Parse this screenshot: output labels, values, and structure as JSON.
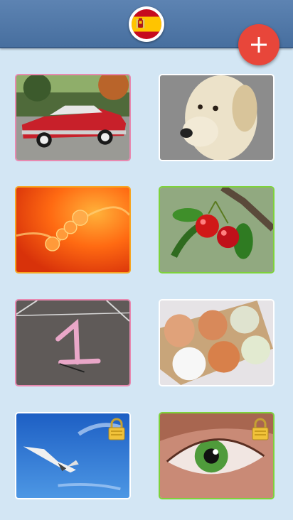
{
  "app": {
    "language_flag": "spain-flag-icon",
    "add_button_icon": "plus-icon",
    "colors": {
      "topbar": "#5078a8",
      "background": "#d3e6f4",
      "add_button": "#e8463a"
    }
  },
  "grid": {
    "cards": [
      {
        "subject": "red-classic-car",
        "border": "#e889b0",
        "locked": false
      },
      {
        "subject": "white-labrador-dog",
        "border": "#ffffff",
        "locked": false
      },
      {
        "subject": "orange-liquid-bubbles",
        "border": "#f6a623",
        "locked": false
      },
      {
        "subject": "red-cherries",
        "border": "#7ed23b",
        "locked": false
      },
      {
        "subject": "chalk-number-one",
        "border": "#e889b0",
        "locked": false
      },
      {
        "subject": "eggs-in-carton",
        "border": "#ffffff",
        "locked": false
      },
      {
        "subject": "seagull-blue-sky",
        "border": "#ffffff",
        "locked": true
      },
      {
        "subject": "green-eye",
        "border": "#7ed23b",
        "locked": true
      }
    ]
  }
}
